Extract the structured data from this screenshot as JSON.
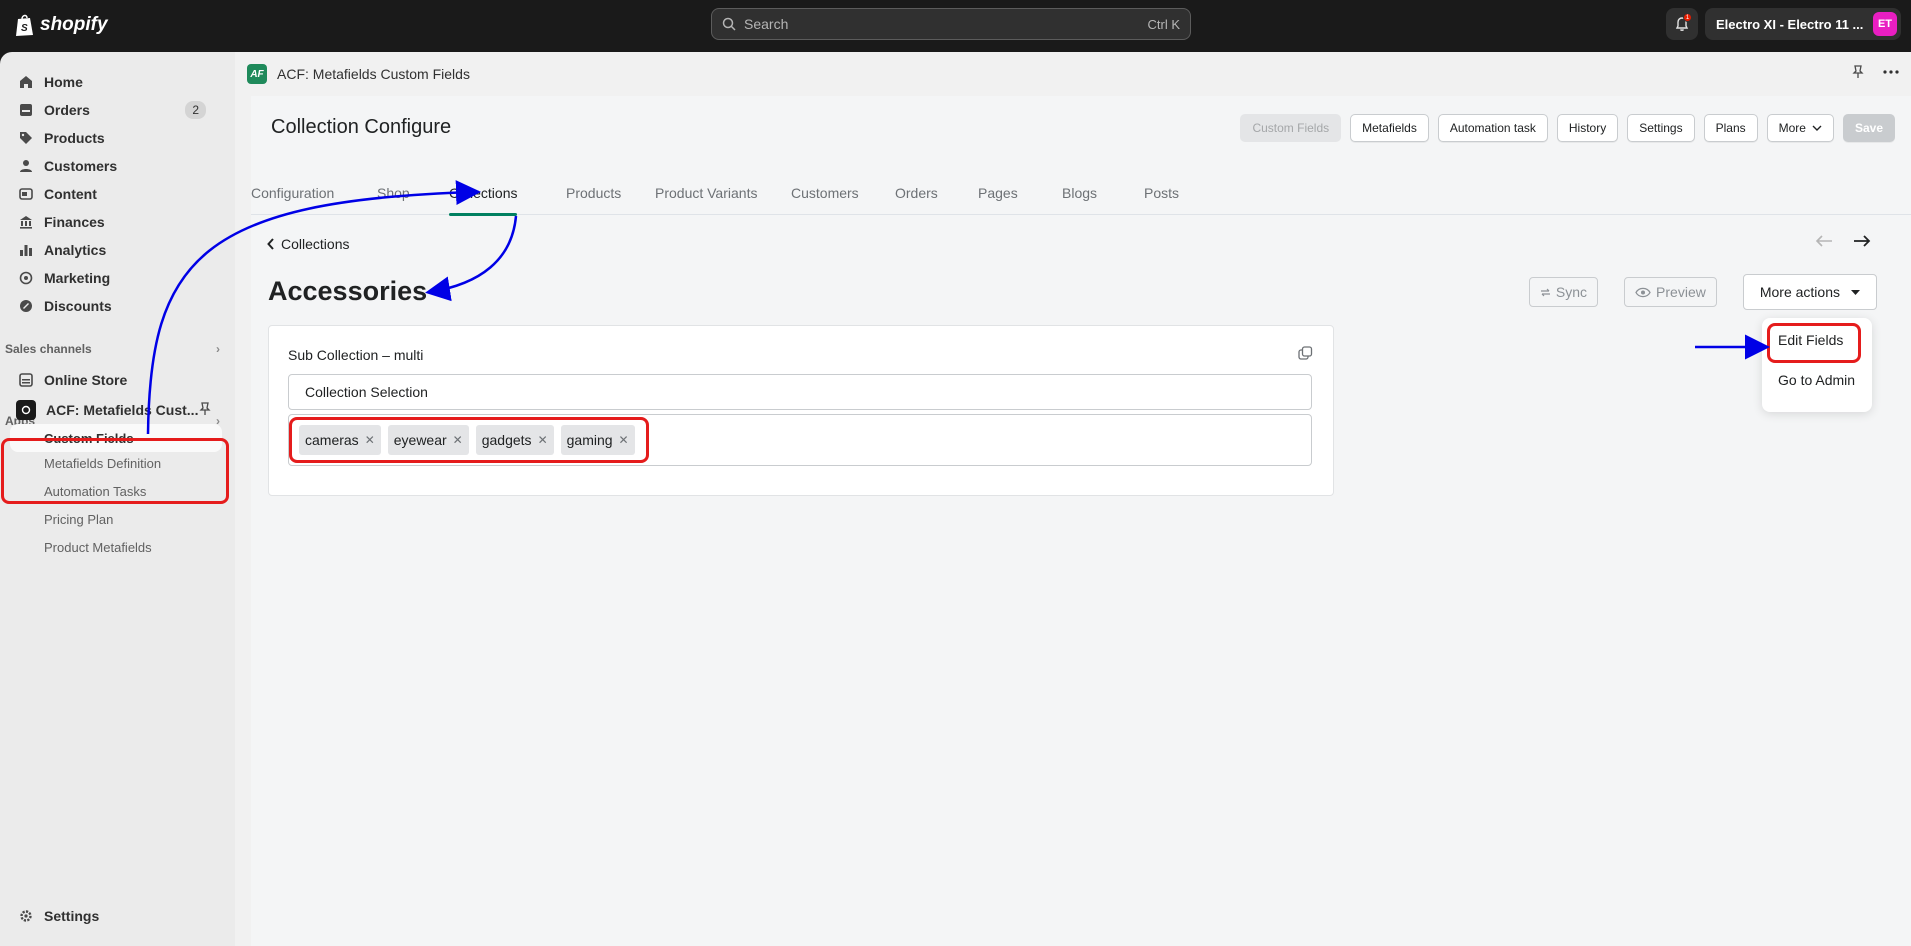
{
  "topbar": {
    "logo_text": "shopify",
    "search_placeholder": "Search",
    "search_shortcut": "Ctrl K",
    "notification_count": "1",
    "store_name": "Electro XI - Electro 11 ...",
    "avatar_initials": "ET"
  },
  "sidebar": {
    "items": [
      {
        "label": "Home",
        "icon": "home-icon"
      },
      {
        "label": "Orders",
        "icon": "orders-icon",
        "badge": "2"
      },
      {
        "label": "Products",
        "icon": "tag-icon"
      },
      {
        "label": "Customers",
        "icon": "person-icon"
      },
      {
        "label": "Content",
        "icon": "content-icon"
      },
      {
        "label": "Finances",
        "icon": "bank-icon"
      },
      {
        "label": "Analytics",
        "icon": "chart-icon"
      },
      {
        "label": "Marketing",
        "icon": "target-icon"
      },
      {
        "label": "Discounts",
        "icon": "discount-icon"
      }
    ],
    "sales_channels_label": "Sales channels",
    "online_store_label": "Online Store",
    "apps_label": "Apps",
    "app_name": "ACF: Metafields Cust...",
    "app_subitems": [
      "Custom Fields",
      "Metafields Definition",
      "Automation Tasks",
      "Pricing Plan",
      "Product Metafields"
    ],
    "settings_label": "Settings"
  },
  "app_header": {
    "title": "ACF: Metafields Custom Fields"
  },
  "page": {
    "title": "Collection Configure",
    "actions": [
      "Custom Fields",
      "Metafields",
      "Automation task",
      "History",
      "Settings",
      "Plans"
    ],
    "more_label": "More",
    "save_label": "Save",
    "tabs": [
      "Configuration",
      "Shop",
      "Collections",
      "Products",
      "Product Variants",
      "Customers",
      "Orders",
      "Pages",
      "Blogs",
      "Posts"
    ],
    "active_tab": "Collections",
    "back_label": "Collections",
    "heading": "Accessories",
    "sync_label": "Sync",
    "preview_label": "Preview",
    "more_actions_label": "More actions",
    "dropdown": [
      "Edit Fields",
      "Go to Admin"
    ]
  },
  "card": {
    "label": "Sub Collection – multi",
    "select_value": "Collection Selection",
    "tags": [
      "cameras",
      "eyewear",
      "gadgets",
      "gaming"
    ]
  },
  "colors": {
    "accent": "#008060",
    "annotation_red": "#e51c1c",
    "annotation_blue": "#0000e6"
  }
}
